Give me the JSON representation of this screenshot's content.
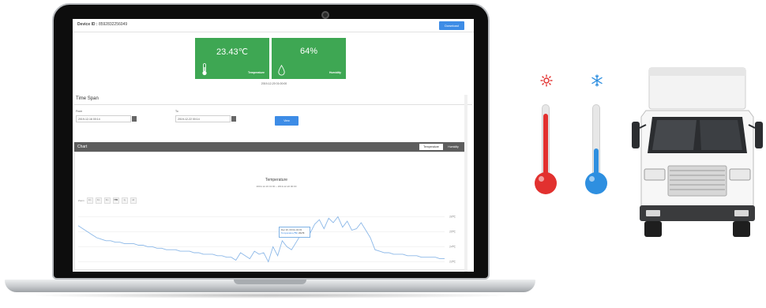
{
  "device": {
    "label": "Device ID :",
    "id": "8592832256049"
  },
  "toolbar": {
    "download_label": "Download"
  },
  "cards": {
    "temperature": {
      "value": "23.43℃",
      "label": "Temperature"
    },
    "humidity": {
      "value": "64%",
      "label": "Humidity"
    },
    "timestamp": "2019-12-20 01:00:00"
  },
  "time_span": {
    "title": "Time Span",
    "from_label": "From",
    "from_value": "2019-12-16 00:14",
    "to_label": "To",
    "to_value": "2019-12-22 00:14",
    "view_label": "View"
  },
  "chart_panel": {
    "title": "Chart",
    "tabs": [
      "Temperature",
      "Humidity"
    ],
    "zoom_label": "Zoom",
    "zoom_options": [
      "1m",
      "3m",
      "6m",
      "YTD",
      "1y",
      "All"
    ],
    "zoom_selected": "YTD"
  },
  "tooltip": {
    "date": "Dec 20, 00:02~02:03",
    "series": "Temperature(℃):",
    "value": "24.70"
  },
  "chart_data": {
    "type": "line",
    "title": "Temperature",
    "subtitle": "2019-12-16 01:00 ~ 2019-12-22 00:00",
    "y_ticks": [
      "26℃",
      "25℃",
      "24℃",
      "23℃"
    ],
    "ylim": [
      22.6,
      26.6
    ],
    "x": [
      0,
      1,
      2,
      3,
      4,
      5,
      6,
      7,
      8,
      9,
      10,
      11,
      12,
      13,
      14,
      15,
      16,
      17,
      18,
      19,
      20,
      21,
      22,
      23,
      24,
      25,
      26,
      27,
      28,
      29,
      30,
      31,
      32,
      33,
      34,
      35,
      36,
      37,
      38,
      39,
      40,
      41,
      42,
      43,
      44,
      45,
      46,
      47,
      48,
      49,
      50,
      51,
      52,
      53,
      54,
      55,
      56,
      57,
      58,
      59,
      60,
      61,
      62,
      63,
      64,
      65,
      66,
      67,
      68,
      69,
      70,
      71,
      72,
      73,
      74,
      75,
      76,
      77,
      78,
      79
    ],
    "series": [
      {
        "name": "Temperature",
        "values": [
          25.4,
          25.2,
          25.0,
          24.8,
          24.6,
          24.5,
          24.4,
          24.4,
          24.3,
          24.3,
          24.2,
          24.2,
          24.2,
          24.1,
          24.1,
          24.0,
          24.0,
          23.9,
          23.9,
          23.8,
          23.8,
          23.8,
          23.7,
          23.7,
          23.7,
          23.6,
          23.6,
          23.5,
          23.5,
          23.5,
          23.4,
          23.4,
          23.3,
          23.3,
          23.1,
          23.6,
          23.4,
          23.2,
          23.7,
          23.5,
          23.6,
          23.0,
          24.0,
          23.4,
          24.4,
          24.0,
          23.8,
          24.3,
          24.8,
          25.0,
          24.9,
          25.5,
          25.8,
          25.2,
          25.9,
          25.6,
          26.0,
          25.3,
          25.7,
          25.1,
          25.2,
          25.6,
          25.1,
          24.6,
          23.8,
          23.7,
          23.6,
          23.6,
          23.5,
          23.5,
          23.5,
          23.4,
          23.4,
          23.4,
          23.3,
          23.3,
          23.3,
          23.3,
          23.2,
          23.2
        ]
      }
    ]
  },
  "colors": {
    "card_green": "#3ea753",
    "button_blue": "#3d8ce6",
    "line_blue": "#8cb8e8",
    "thermo_hot": "#e2312f",
    "thermo_cold": "#2e8fe0"
  }
}
